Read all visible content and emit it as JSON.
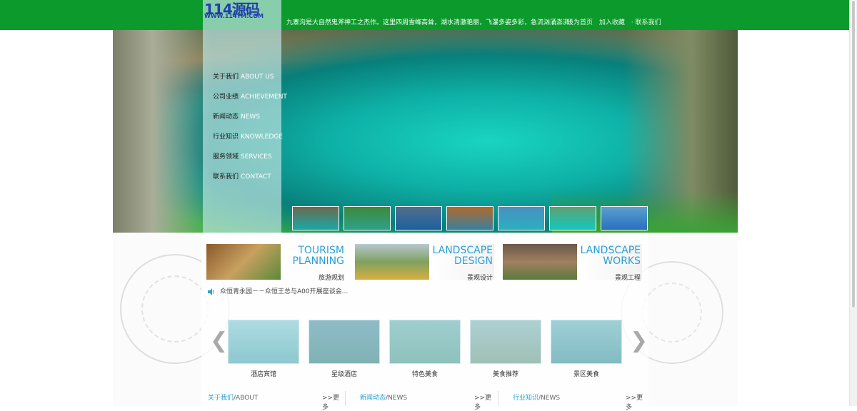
{
  "logo": {
    "main": "114源码",
    "sub": "WWW.114YM.COM"
  },
  "header": {
    "slogan": "九寨沟是大自然鬼斧神工之杰作。这里四周雪峰高耸，湖水清澈艳丽，飞瀑多姿多彩，急流汹涌澎湃！",
    "links": [
      "设为首页",
      "加入收藏",
      "· 联系我们"
    ]
  },
  "nav": [
    {
      "cn": "关于我们",
      "en": "ABOUT US"
    },
    {
      "cn": "公司业绩",
      "en": "ACHIEVEMENT"
    },
    {
      "cn": "新闻动态",
      "en": "NEWS"
    },
    {
      "cn": "行业知识",
      "en": "KNOWLEDGE"
    },
    {
      "cn": "服务领域",
      "en": "SERVICES"
    },
    {
      "cn": "联系我们",
      "en": "CONTACT"
    }
  ],
  "cards": [
    {
      "en1": "TOURISM",
      "en2": "PLANNING",
      "cn": "旅游规划"
    },
    {
      "en1": "LANDSCAPE",
      "en2": "DESIGN",
      "cn": "景观设计"
    },
    {
      "en1": "LANDSCAPE",
      "en2": "WORKS",
      "cn": "景观工程"
    }
  ],
  "news_ticker": "众恒青永园－－众恒王总与A00开展座谈会...",
  "products": [
    "酒店宾馆",
    "星级酒店",
    "特色美食",
    "美食推荐",
    "景区美食"
  ],
  "arrows": {
    "left": "❮",
    "right": "❯"
  },
  "sections": [
    {
      "cn": "关于我们",
      "en": "/ABOUT",
      "more": ">>更多"
    },
    {
      "cn": "新闻动态",
      "en": "/NEWS",
      "more": ">>更多"
    },
    {
      "cn": "行业知识",
      "en": "/NEWS",
      "more": ">>更多"
    }
  ]
}
